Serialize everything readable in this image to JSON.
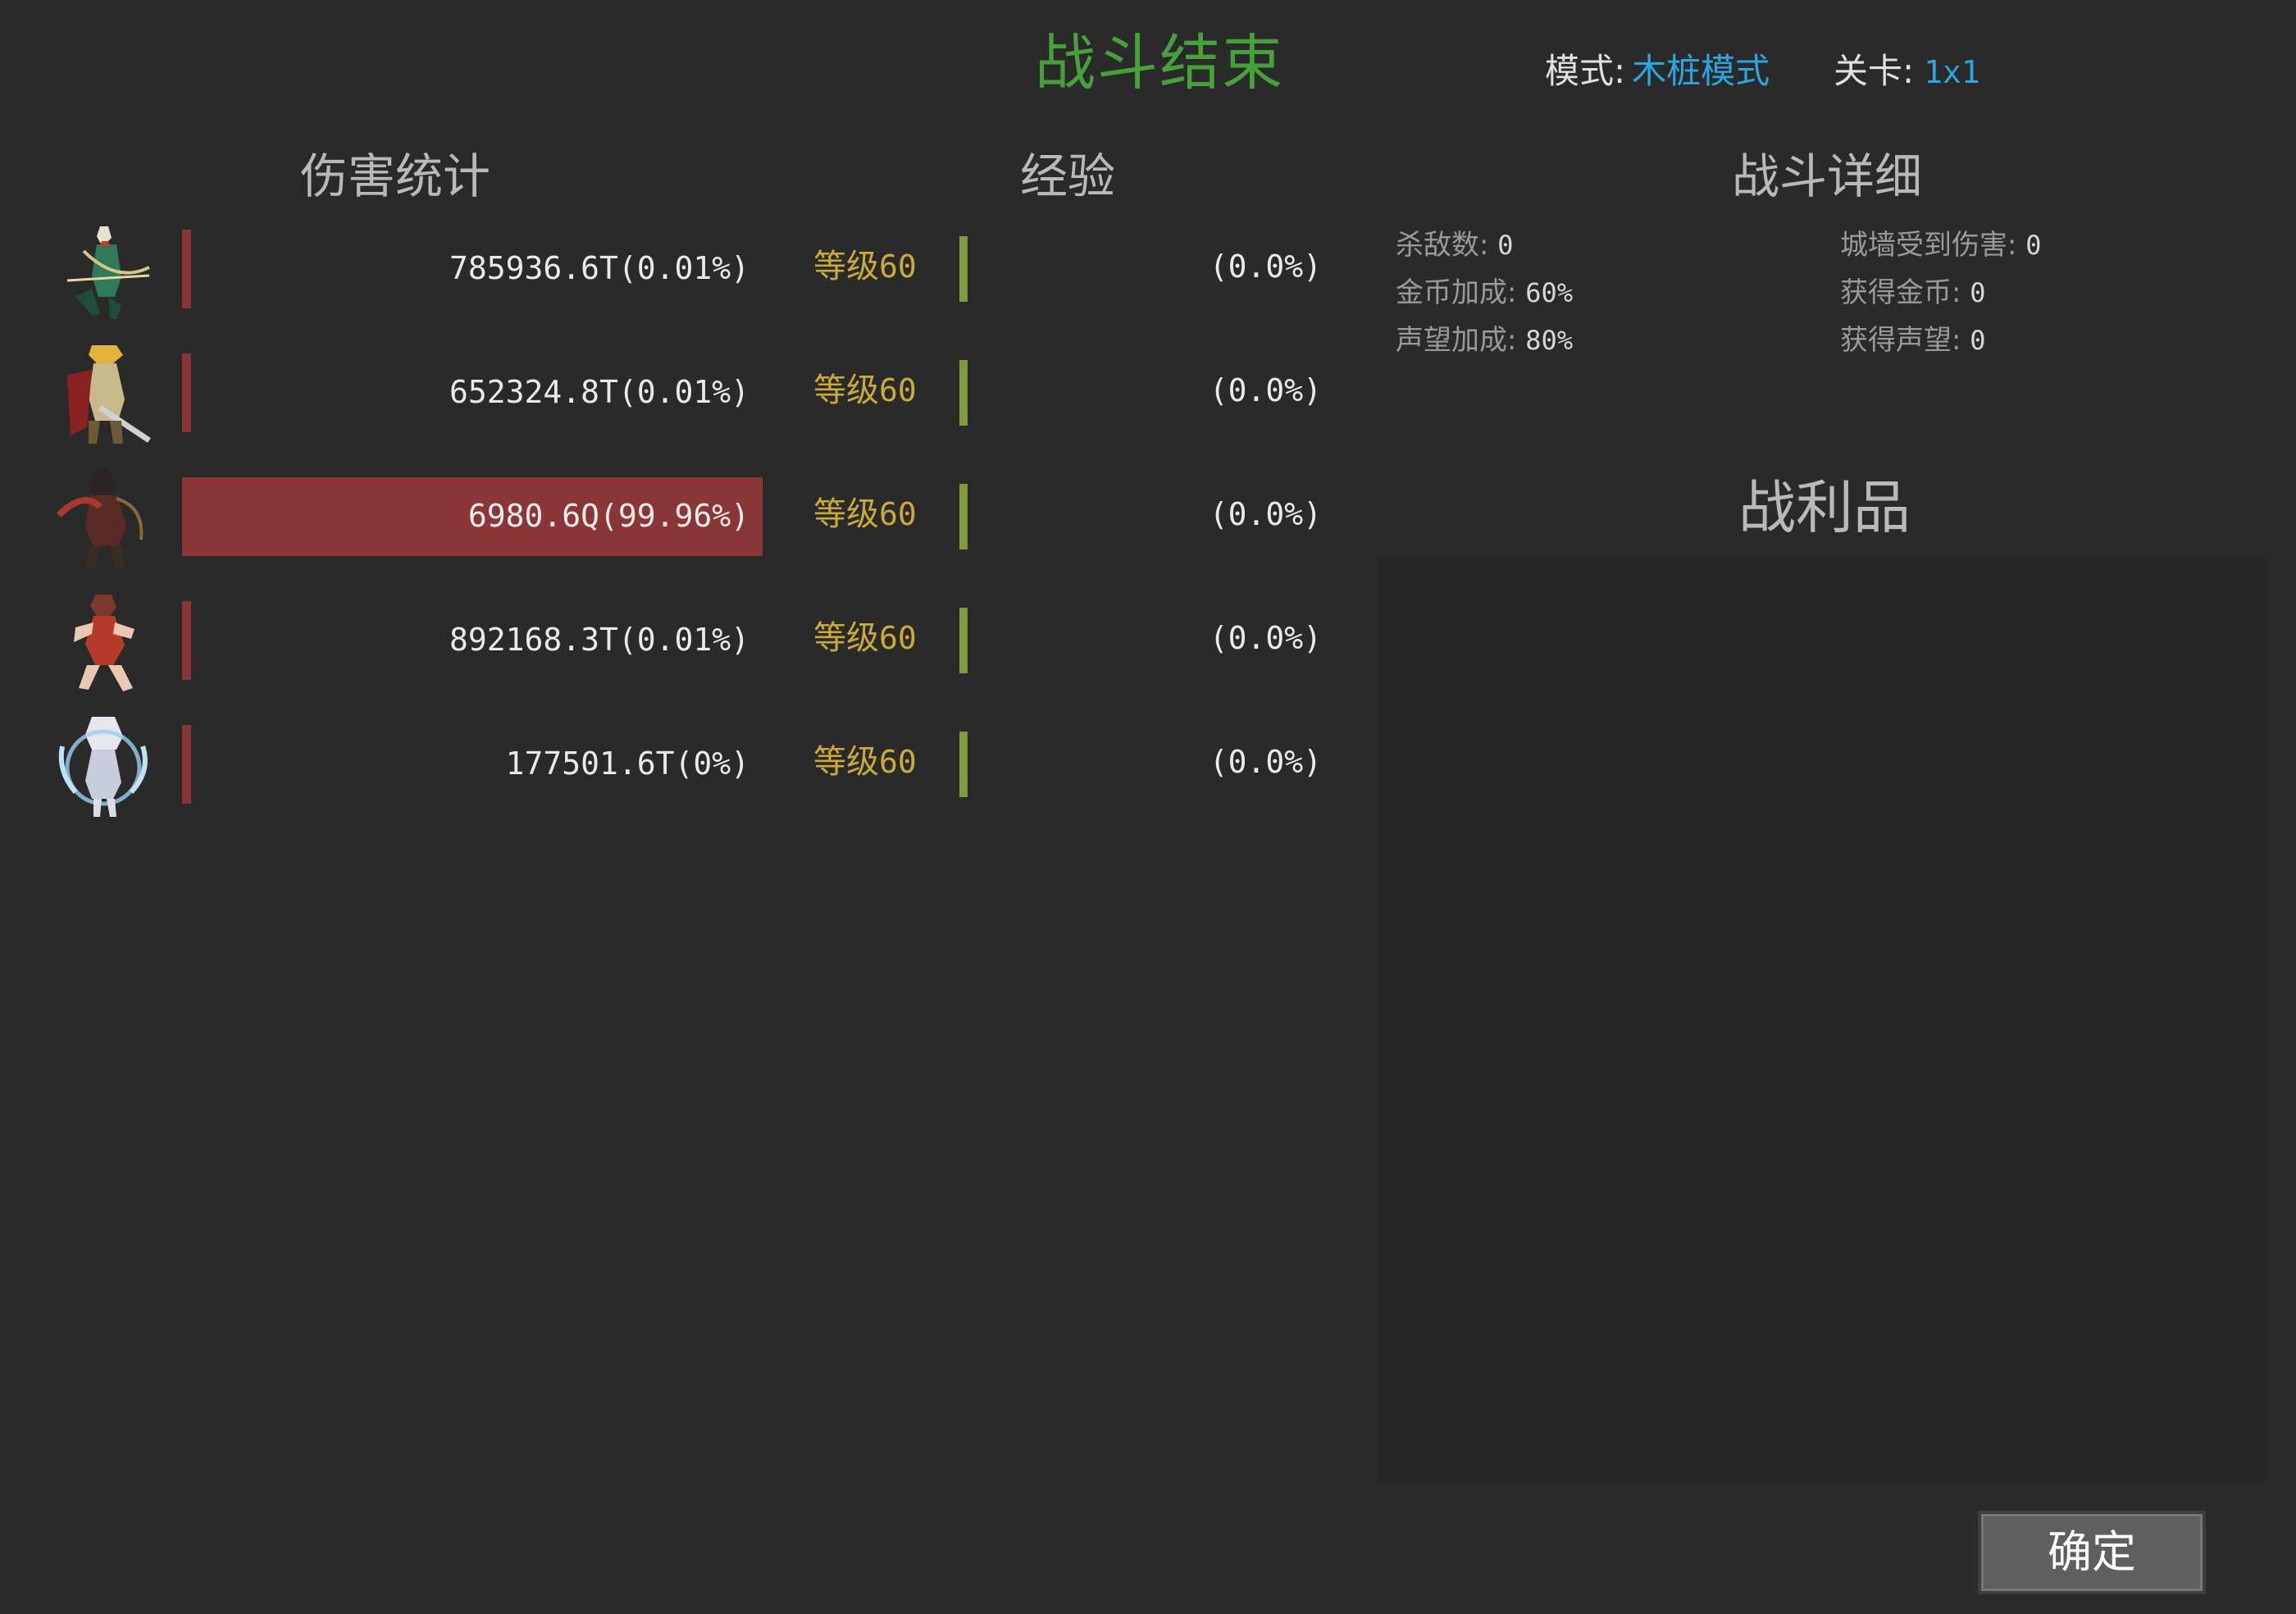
{
  "header": {
    "title": "战斗结束",
    "mode_label": "模式:",
    "mode_value": "木桩模式",
    "stage_label": "关卡:",
    "stage_value": "1x1"
  },
  "sections": {
    "damage": "伤害统计",
    "exp": "经验",
    "details": "战斗详细",
    "loot": "战利品"
  },
  "heroes": [
    {
      "avatar": "archer-hero-icon",
      "damage_text": "785936.6T(0.01%)",
      "damage_fraction": 0.0001,
      "level_label": "等级",
      "level": "60",
      "exp_text": "(0.0%)",
      "exp_fraction": 0
    },
    {
      "avatar": "knight-hero-icon",
      "damage_text": "652324.8T(0.01%)",
      "damage_fraction": 0.0001,
      "level_label": "等级",
      "level": "60",
      "exp_text": "(0.0%)",
      "exp_fraction": 0
    },
    {
      "avatar": "assassin-hero-icon",
      "damage_text": "6980.6Q(99.96%)",
      "damage_fraction": 0.9996,
      "level_label": "等级",
      "level": "60",
      "exp_text": "(0.0%)",
      "exp_fraction": 0
    },
    {
      "avatar": "fighter-hero-icon",
      "damage_text": "892168.3T(0.01%)",
      "damage_fraction": 0.0001,
      "level_label": "等级",
      "level": "60",
      "exp_text": "(0.0%)",
      "exp_fraction": 0
    },
    {
      "avatar": "mage-hero-icon",
      "damage_text": "177501.6T(0%)",
      "damage_fraction": 0,
      "level_label": "等级",
      "level": "60",
      "exp_text": "(0.0%)",
      "exp_fraction": 0
    }
  ],
  "details": {
    "kills_label": "杀敌数:",
    "kills": "0",
    "wall_damage_label": "城墙受到伤害:",
    "wall_damage": "0",
    "gold_bonus_label": "金币加成:",
    "gold_bonus": "60%",
    "gold_gain_label": "获得金币:",
    "gold_gain": "0",
    "fame_bonus_label": "声望加成:",
    "fame_bonus": "80%",
    "fame_gain_label": "获得声望:",
    "fame_gain": "0"
  },
  "confirm_label": "确定",
  "colors": {
    "title": "#47a13a",
    "accent": "#2aa6e0",
    "damage_bar": "#8a3637",
    "exp_bar": "#7f9a3b",
    "level": "#c9aa3a"
  }
}
